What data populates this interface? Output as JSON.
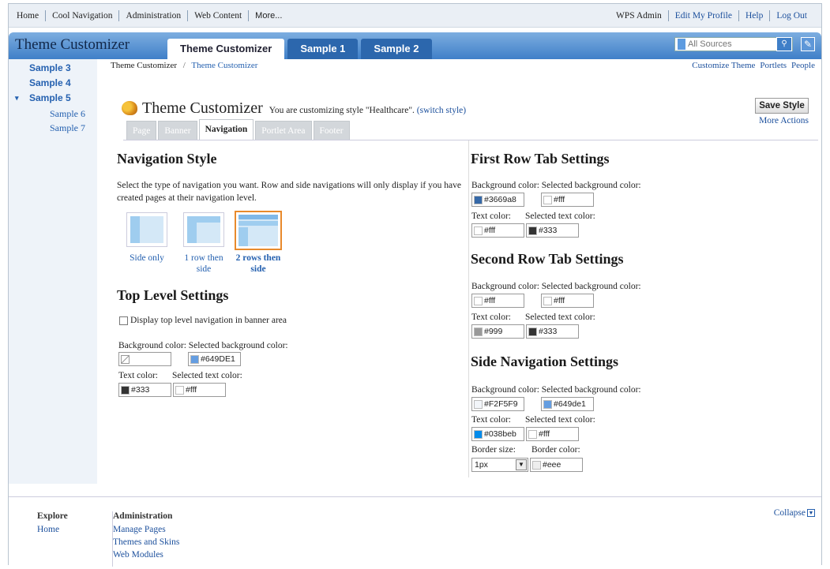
{
  "util": {
    "left": [
      "Home",
      "Cool Navigation",
      "Administration",
      "Web Content",
      "More..."
    ],
    "user": "WPS Admin",
    "right": [
      "Edit My Profile",
      "Help",
      "Log Out"
    ]
  },
  "banner": {
    "title": "Theme Customizer",
    "tabs": [
      "Theme Customizer",
      "Sample 1",
      "Sample 2"
    ],
    "search_placeholder": "All Sources"
  },
  "sidenav": {
    "top": [
      "Sample 3",
      "Sample 4",
      "Sample 5"
    ],
    "sub": [
      "Sample 6",
      "Sample 7"
    ],
    "expand_icon": "▾"
  },
  "breadcrumb": [
    "Theme Customizer",
    "/",
    "Theme Customizer"
  ],
  "toplinks": [
    "Customize Theme",
    "Portlets",
    "People"
  ],
  "header": {
    "title": "Theme Customizer",
    "desc": "You are customizing style \"Healthcare\".",
    "switch": "(switch style)",
    "save": "Save Style",
    "more": "More Actions"
  },
  "content_tabs": [
    "Page",
    "Banner",
    "Navigation",
    "Portlet Area",
    "Footer"
  ],
  "nav_style": {
    "title": "Navigation Style",
    "text1": "Select the type of navigation you want. Row and side navigations will only display if you have",
    "text2": "created pages at their navigation level.",
    "options": [
      "Side only",
      "1 row then",
      "side",
      "2 rows then",
      "side"
    ]
  },
  "top_level": {
    "title": "Top Level Settings",
    "checkbox": "Display top level navigation in banner area",
    "bg_label": "Background color: Selected background color:",
    "txt_label1": "Text color:",
    "txt_label2": "Selected text color:",
    "bg": "",
    "selbg": "#649DE1",
    "txt": "#333",
    "seltxt": "#fff"
  },
  "first_row": {
    "title": "First Row Tab Settings",
    "bg_label": "Background color: Selected background color:",
    "txt_label1": "Text color:",
    "txt_label2": "Selected text color:",
    "bg": "#3669a8",
    "selbg": "#fff",
    "txt": "#fff",
    "seltxt": "#333"
  },
  "second_row": {
    "title": "Second Row Tab Settings",
    "bg_label": "Background color: Selected background color:",
    "txt_label1": "Text color:",
    "txt_label2": "Selected text color:",
    "bg": "#fff",
    "selbg": "#fff",
    "txt": "#999",
    "seltxt": "#333"
  },
  "side_nav": {
    "title": "Side Navigation Settings",
    "bg_label": "Background color: Selected background color:",
    "txt_label1": "Text color:",
    "txt_label2": "Selected text color:",
    "border_label1": "Border size:",
    "border_label2": "Border color:",
    "bg": "#F2F5F9",
    "selbg": "#649de1",
    "txt": "#038beb",
    "seltxt": "#fff",
    "border_size": "1px",
    "border_color": "#eee"
  },
  "footer": {
    "explore": "Explore",
    "explore_links": [
      "Home"
    ],
    "admin": "Administration",
    "admin_links": [
      "Manage Pages",
      "Themes and Skins",
      "Web Modules"
    ],
    "collapse": "Collapse"
  },
  "colors": {
    "banner": "#3f7fc8",
    "link": "#2561b0",
    "selected_layout": "#e88a2c"
  }
}
